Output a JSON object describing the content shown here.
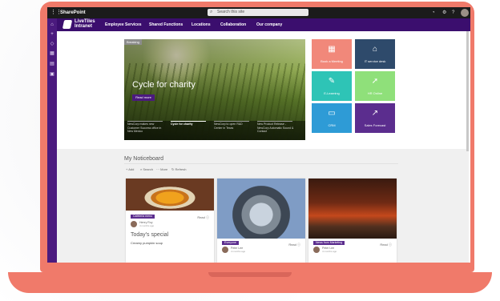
{
  "topbar": {
    "app_name": "SharePoint",
    "search_placeholder": "Search this site",
    "icons": [
      "waffle-icon",
      "search-icon",
      "bell-icon",
      "settings-icon",
      "help-icon",
      "avatar"
    ]
  },
  "nav": {
    "logo_line1": "LiveTiles",
    "logo_line2": "Intranet",
    "items": [
      "Employee Services",
      "Shared Functions",
      "Locations",
      "Collaboration",
      "Our company"
    ]
  },
  "rail": {
    "icons": [
      "home-icon",
      "add-icon",
      "tag-icon",
      "apps-icon",
      "document-icon",
      "calendar-icon"
    ]
  },
  "hero": {
    "badge": "Breaking",
    "title": "Cycle for charity",
    "button": "Read more",
    "strip": [
      {
        "text": "NewCorp makes new Customer Success office in New Mexico",
        "active": false
      },
      {
        "text": "Cycle for charity",
        "active": true
      },
      {
        "text": "NewCorp to open R&D Center in Texas",
        "active": false
      },
      {
        "text": "New Product Release - NewCorp Automatic Sound & Contact",
        "active": false
      }
    ]
  },
  "tiles": [
    {
      "label": "Book a Meeting",
      "icon": "calendar-icon",
      "glyph": "▦",
      "color": "#f1887a"
    },
    {
      "label": "IT service desk",
      "icon": "service-desk-icon",
      "glyph": "⌂",
      "color": "#2e4a6b"
    },
    {
      "label": "E-Learning",
      "icon": "graduation-cap-icon",
      "glyph": "✎",
      "color": "#2ec4b6"
    },
    {
      "label": "HR Online",
      "icon": "pointer-click-icon",
      "glyph": "➚",
      "color": "#8fe07a"
    },
    {
      "label": "CRM",
      "icon": "crm-icon",
      "glyph": "▭",
      "color": "#2e9bd6"
    },
    {
      "label": "Sales Forecast",
      "icon": "chart-icon",
      "glyph": "↗",
      "color": "#5b2d8e"
    }
  ],
  "noticeboard": {
    "title": "My Noticeboard",
    "commands": [
      "+ Add",
      "⌕ Search",
      "··· More",
      "↻ Refresh"
    ],
    "cards": [
      {
        "tag": "Cafeteria menu",
        "author": "Henry Roy",
        "date": "4 months ago",
        "read": "Read ⓘ",
        "title": "Today's special",
        "subtitle": "Creamy pumpkin soup"
      },
      {
        "tag": "Everyone",
        "author": "Peter Lee",
        "date": "4 months ago",
        "read": "Read ⓘ",
        "title": "",
        "subtitle": ""
      },
      {
        "tag": "News from Marketing",
        "author": "Peter Lee",
        "date": "4 months ago",
        "read": "Read ⓘ",
        "title": "",
        "subtitle": ""
      }
    ]
  },
  "colors": {
    "laptop": "#f07a6a",
    "nav": "#3b0e6e",
    "rail": "#4b1a7e",
    "topbar": "#1b1b1b"
  }
}
